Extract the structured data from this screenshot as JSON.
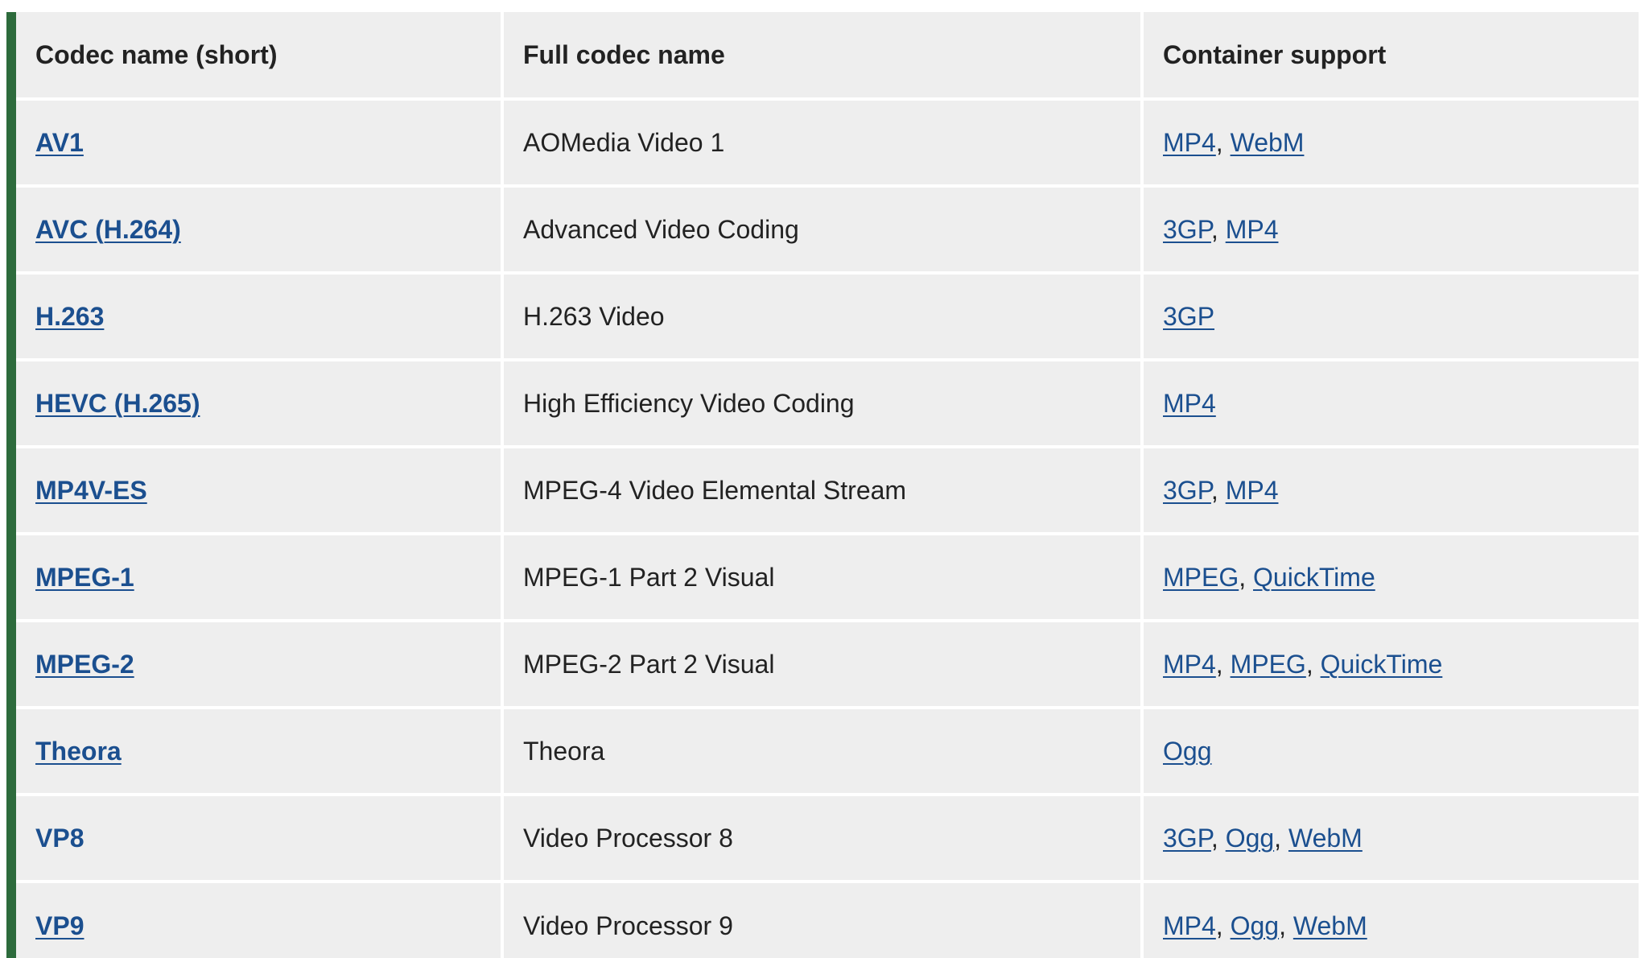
{
  "headers": [
    "Codec name (short)",
    "Full codec name",
    "Container support"
  ],
  "rows": [
    {
      "short": "AV1",
      "full": "AOMedia Video 1",
      "containers": [
        "MP4",
        "WebM"
      ],
      "short_underlined": true
    },
    {
      "short": "AVC (H.264)",
      "full": "Advanced Video Coding",
      "containers": [
        "3GP",
        "MP4"
      ],
      "short_underlined": true
    },
    {
      "short": "H.263",
      "full": "H.263 Video",
      "containers": [
        "3GP"
      ],
      "short_underlined": true
    },
    {
      "short": "HEVC (H.265)",
      "full": "High Efficiency Video Coding",
      "containers": [
        "MP4"
      ],
      "short_underlined": true
    },
    {
      "short": "MP4V-ES",
      "full": "MPEG-4 Video Elemental Stream",
      "containers": [
        "3GP",
        "MP4"
      ],
      "short_underlined": true
    },
    {
      "short": "MPEG-1",
      "full": "MPEG-1 Part 2 Visual",
      "containers": [
        "MPEG",
        "QuickTime"
      ],
      "short_underlined": true
    },
    {
      "short": "MPEG-2",
      "full": "MPEG-2 Part 2 Visual",
      "containers": [
        "MP4",
        "MPEG",
        "QuickTime"
      ],
      "short_underlined": true
    },
    {
      "short": "Theora",
      "full": "Theora",
      "containers": [
        "Ogg"
      ],
      "short_underlined": true
    },
    {
      "short": "VP8",
      "full": "Video Processor 8",
      "containers": [
        "3GP",
        "Ogg",
        "WebM"
      ],
      "short_underlined": false
    },
    {
      "short": "VP9",
      "full": "Video Processor 9",
      "containers": [
        "MP4",
        "Ogg",
        "WebM"
      ],
      "short_underlined": true
    }
  ],
  "colors": {
    "accent_bar": "#2d6b3c",
    "cell_background": "#eeeeee",
    "link": "#1b4f8f",
    "text": "#222222"
  }
}
